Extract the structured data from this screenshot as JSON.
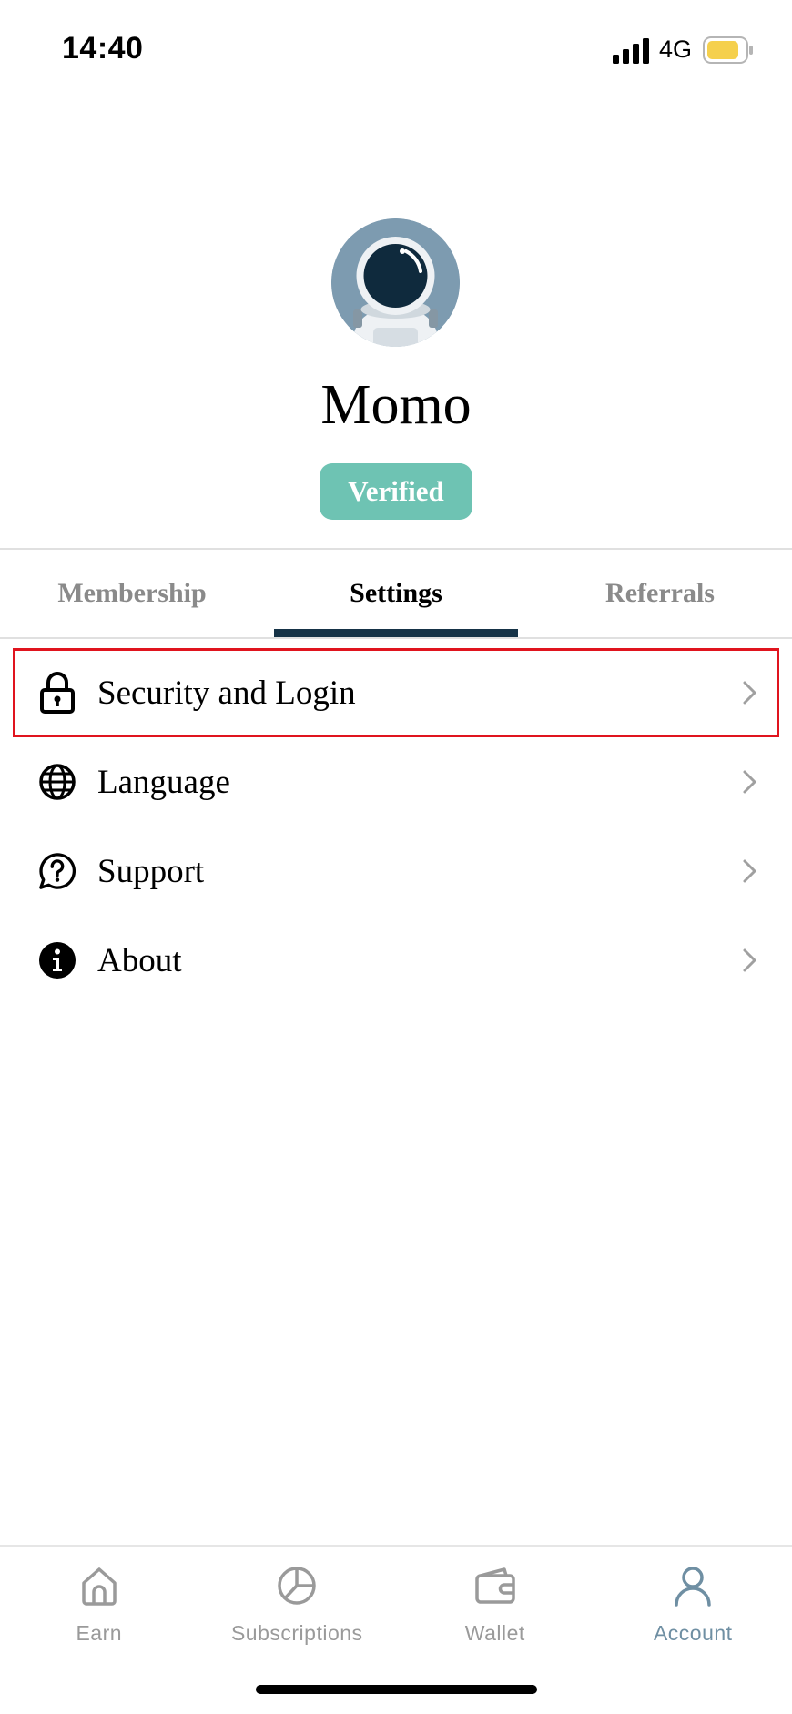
{
  "status_bar": {
    "time": "14:40",
    "network": "4G",
    "battery_color": "#f5d04d"
  },
  "profile": {
    "name": "Momo",
    "badge": "Verified",
    "badge_color": "#6ec3b3",
    "avatar_icon": "astronaut-avatar"
  },
  "tabs": [
    {
      "label": "Membership",
      "active": false
    },
    {
      "label": "Settings",
      "active": true
    },
    {
      "label": "Referrals",
      "active": false
    }
  ],
  "settings": [
    {
      "label": "Security and Login",
      "icon": "lock-icon"
    },
    {
      "label": "Language",
      "icon": "globe-icon"
    },
    {
      "label": "Support",
      "icon": "help-bubble-icon"
    },
    {
      "label": "About",
      "icon": "info-icon"
    }
  ],
  "bottom_nav": [
    {
      "label": "Earn",
      "icon": "home-icon",
      "active": false
    },
    {
      "label": "Subscriptions",
      "icon": "pie-chart-icon",
      "active": false
    },
    {
      "label": "Wallet",
      "icon": "wallet-icon",
      "active": false
    },
    {
      "label": "Account",
      "icon": "user-icon",
      "active": true
    }
  ],
  "colors": {
    "accent": "#163347",
    "highlight_border": "#e0141e",
    "nav_active": "#6f8fa3",
    "nav_inactive": "#9a9a9a"
  }
}
